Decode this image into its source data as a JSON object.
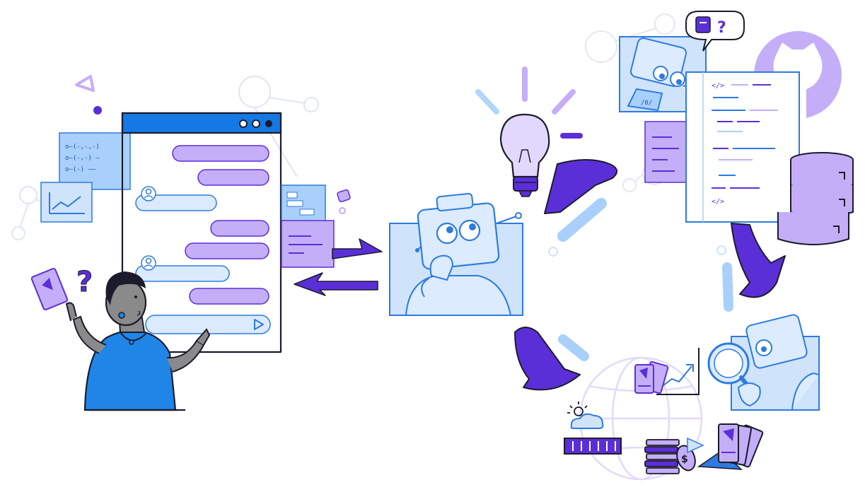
{
  "illustration": {
    "code_tokens": [
      "o—(-,-,-)",
      "o—(-,-) —",
      "o—(-) ——"
    ],
    "tag_open": "</>",
    "tag_close": "</>",
    "binary_label": "/0/",
    "question_mark": "?",
    "currency_symbol": "$"
  },
  "colors": {
    "purple": "#5b2fd8",
    "lavender": "#c4aef8",
    "light_blue": "#cfe3fb",
    "mid_blue": "#9cc8f7",
    "blue": "#2d7be0",
    "chat_bar": "#1479e4",
    "ink": "#1b1b2b",
    "skin": "#8a8a8a",
    "shirt": "#1f86e8"
  },
  "icons": [
    "triangle-icon",
    "chat-window",
    "user-avatar-icon",
    "send-arrow-icon",
    "question-icon",
    "lightbulb-icon",
    "robot-thinking",
    "robot-reading",
    "robot-searching",
    "github-logo-icon",
    "database-icon",
    "globe-icon",
    "weather-icon",
    "calendar-icon",
    "coins-icon",
    "ticket-icon",
    "chart-icon",
    "code-panel",
    "arrow-icon"
  ]
}
